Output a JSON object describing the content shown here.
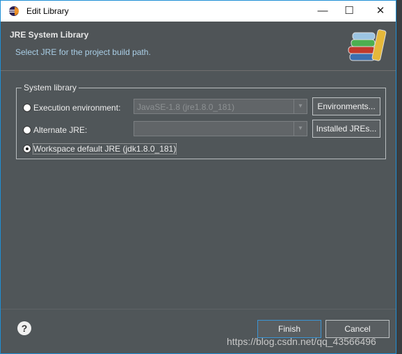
{
  "window": {
    "title": "Edit Library",
    "controls": {
      "minimize": "—",
      "maximize": "☐",
      "close": "✕"
    }
  },
  "header": {
    "title": "JRE System Library",
    "description": "Select JRE for the project build path."
  },
  "group": {
    "label": "System library"
  },
  "options": [
    {
      "label": "Execution environment:",
      "checked": false,
      "combo_value": "JavaSE-1.8 (jre1.8.0_181)",
      "button": "Environments..."
    },
    {
      "label": "Alternate JRE:",
      "checked": false,
      "combo_value": "",
      "button": "Installed JREs..."
    },
    {
      "label": "Workspace default JRE (jdk1.8.0_181)",
      "checked": true
    }
  ],
  "footer": {
    "help": "?",
    "finish": "Finish",
    "cancel": "Cancel"
  },
  "watermark": "https://blog.csdn.net/qq_43566496",
  "colors": {
    "dialog_bg": "#505659",
    "accent": "#1e8fd6",
    "description": "#a9cee6"
  }
}
